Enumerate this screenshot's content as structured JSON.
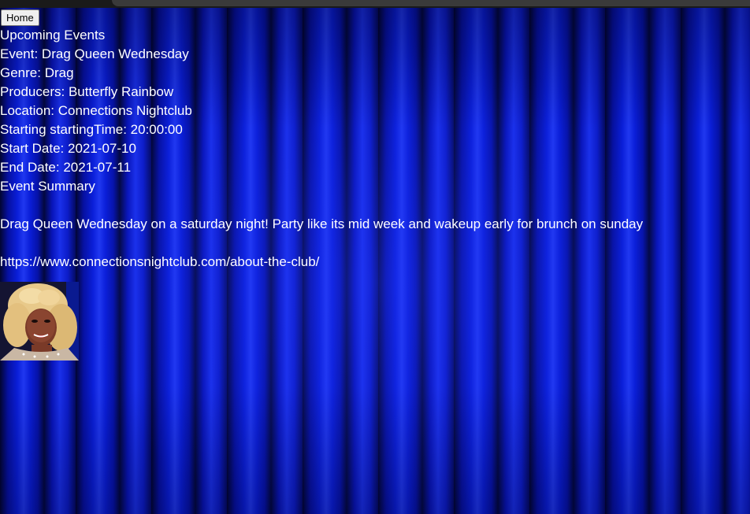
{
  "nav": {
    "home_label": "Home"
  },
  "page": {
    "heading": "Upcoming Events"
  },
  "event": {
    "name_label": "Event: ",
    "name": "Drag Queen Wednesday",
    "genre_label": "Genre: ",
    "genre": "Drag",
    "producers_label": "Producers: ",
    "producers": "Butterfly Rainbow",
    "location_label": "Location: ",
    "location": "Connections Nightclub",
    "start_time_label": "Starting startingTime: ",
    "start_time": "20:00:00",
    "start_date_label": "Start Date: ",
    "start_date": "2021-07-10",
    "end_date_label": "End Date: ",
    "end_date": "2021-07-11",
    "summary_heading": "Event Summary",
    "summary": "Drag Queen Wednesday on a saturday night! Party like its mid week and wakeup early for brunch on sunday",
    "link": "https://www.connectionsnightclub.com/about-the-club/"
  },
  "colors": {
    "background": "#0a14b8",
    "text": "#ffffff"
  }
}
